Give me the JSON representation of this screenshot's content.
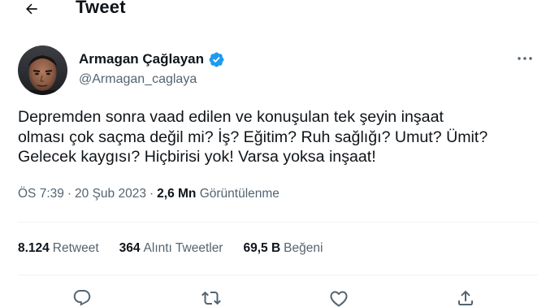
{
  "header": {
    "title": "Tweet",
    "back_icon": "arrow-left-icon"
  },
  "author": {
    "display_name": "Armagan Çağlayan",
    "handle": "@Armagan_caglaya",
    "verified_icon": "verified-badge-icon",
    "verified_color": "#1d9bf0",
    "more_icon": "more-horizontal-icon"
  },
  "tweet": {
    "text_lines": [
      "Depremden sonra vaad edilen ve konuşulan tek şeyin inşaat",
      "olması çok saçma değil mi? İş? Eğitim? Ruh sağlığı? Umut? Ümit?",
      "Gelecek kaygısı? Hiçbirisi yok! Varsa yoksa inşaat!"
    ],
    "time": "ÖS 7:39",
    "date": "20 Şub 2023",
    "views_count": "2,6 Mn",
    "views_label": "Görüntülenme"
  },
  "stats": [
    {
      "count": "8.124",
      "label": "Retweet"
    },
    {
      "count": "364",
      "label": "Alıntı Tweetler"
    },
    {
      "count": "69,5 B",
      "label": "Beğeni"
    }
  ],
  "actions": [
    {
      "icon": "reply-icon"
    },
    {
      "icon": "retweet-icon"
    },
    {
      "icon": "like-heart-icon"
    },
    {
      "icon": "share-icon"
    }
  ],
  "colors": {
    "text_primary": "#0f1419",
    "text_secondary": "#536471",
    "divider": "#eff3f4",
    "accent": "#1d9bf0"
  }
}
